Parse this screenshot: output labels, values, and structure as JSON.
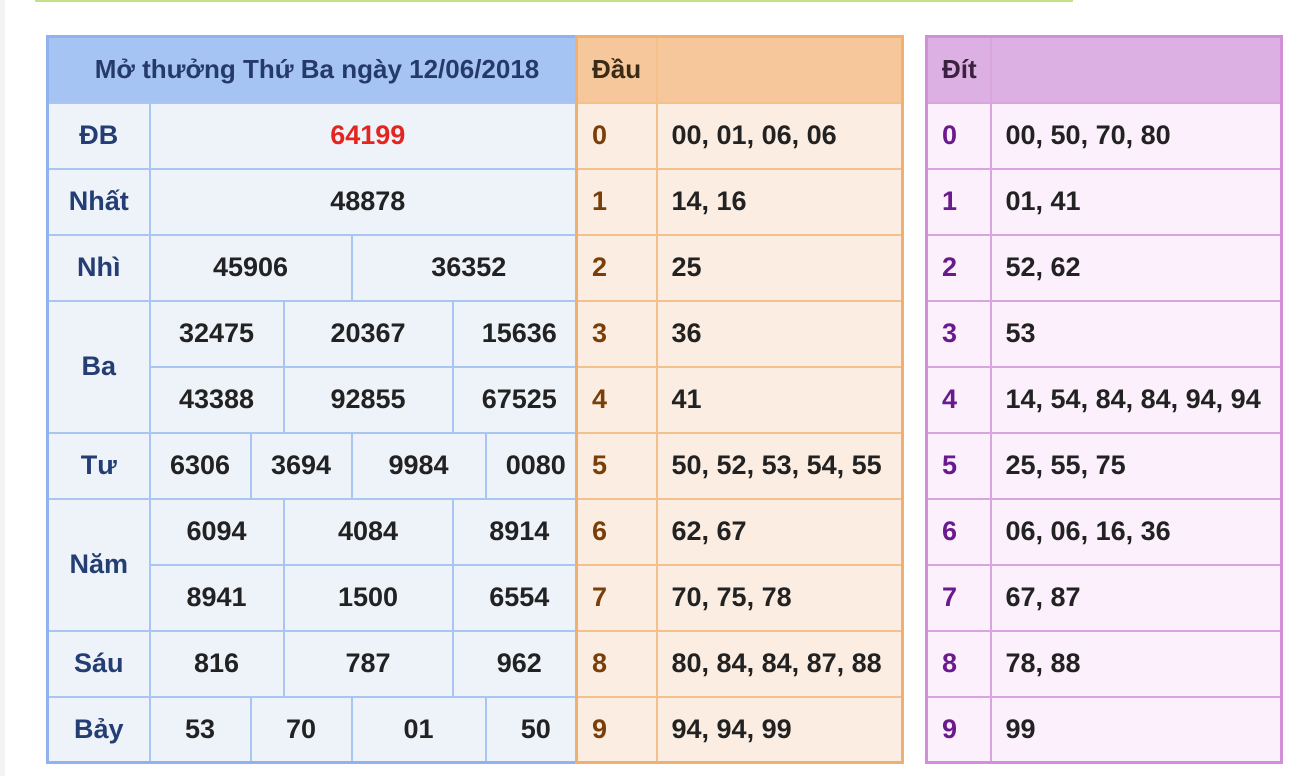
{
  "results": {
    "title": "Mở thưởng Thứ Ba ngày 12/06/2018",
    "rows": [
      {
        "label": "ĐB",
        "values": [
          "64199"
        ]
      },
      {
        "label": "Nhất",
        "values": [
          "48878"
        ]
      },
      {
        "label": "Nhì",
        "values": [
          "45906",
          "36352"
        ]
      },
      {
        "label": "Ba",
        "values": [
          "32475",
          "20367",
          "15636",
          "43388",
          "92855",
          "67525"
        ]
      },
      {
        "label": "Tư",
        "values": [
          "6306",
          "3694",
          "9984",
          "0080"
        ]
      },
      {
        "label": "Năm",
        "values": [
          "6094",
          "4084",
          "8914",
          "8941",
          "1500",
          "6554"
        ]
      },
      {
        "label": "Sáu",
        "values": [
          "816",
          "787",
          "962"
        ]
      },
      {
        "label": "Bảy",
        "values": [
          "53",
          "70",
          "01",
          "50"
        ]
      }
    ]
  },
  "dau": {
    "title": "Đầu",
    "rows": [
      {
        "key": "0",
        "value": "00, 01, 06, 06"
      },
      {
        "key": "1",
        "value": "14, 16"
      },
      {
        "key": "2",
        "value": "25"
      },
      {
        "key": "3",
        "value": "36"
      },
      {
        "key": "4",
        "value": "41"
      },
      {
        "key": "5",
        "value": "50, 52, 53, 54, 55"
      },
      {
        "key": "6",
        "value": "62, 67"
      },
      {
        "key": "7",
        "value": "70, 75, 78"
      },
      {
        "key": "8",
        "value": "80, 84, 84, 87, 88"
      },
      {
        "key": "9",
        "value": "94, 94, 99"
      }
    ]
  },
  "dit": {
    "title": "Đít",
    "rows": [
      {
        "key": "0",
        "value": "00, 50, 70, 80"
      },
      {
        "key": "1",
        "value": "01, 41"
      },
      {
        "key": "2",
        "value": "52, 62"
      },
      {
        "key": "3",
        "value": "53"
      },
      {
        "key": "4",
        "value": "14, 54, 84, 84, 94, 94"
      },
      {
        "key": "5",
        "value": "25, 55, 75"
      },
      {
        "key": "6",
        "value": "06, 06, 16, 36"
      },
      {
        "key": "7",
        "value": "67, 87"
      },
      {
        "key": "8",
        "value": "78, 88"
      },
      {
        "key": "9",
        "value": "99"
      }
    ]
  },
  "colors": {
    "special_prize": "#e3241f",
    "results_header": "#a5c4f4",
    "dau_header": "#f6c79a",
    "dit_header": "#ddb0e3"
  }
}
